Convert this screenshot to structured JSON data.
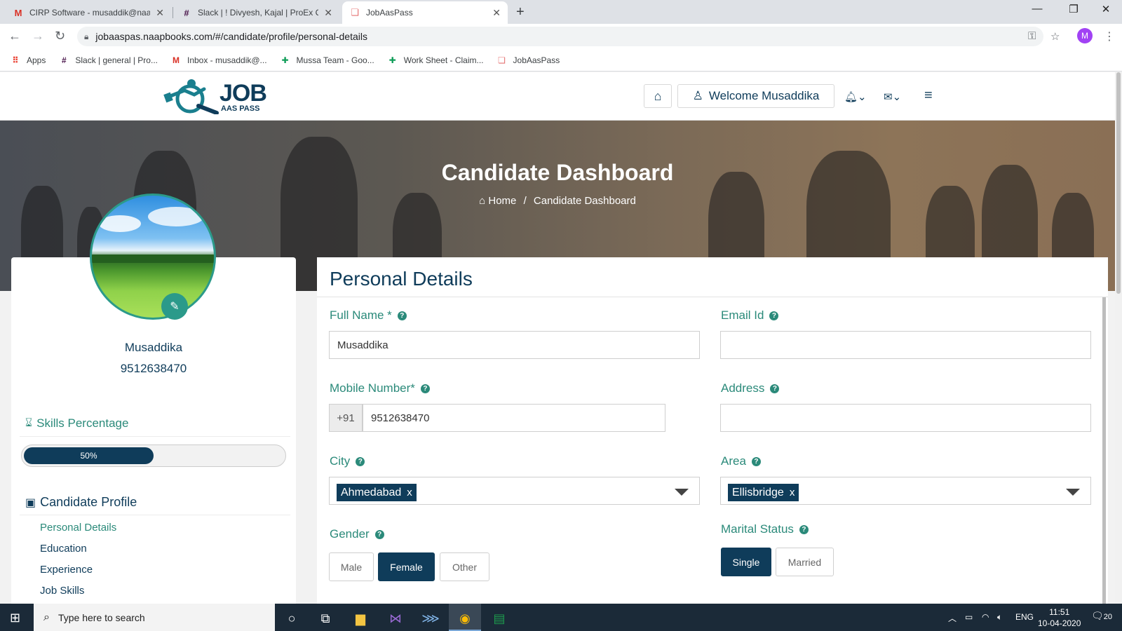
{
  "browser": {
    "tabs": [
      {
        "title": "CIRP Software - musaddik@naap",
        "icon": "gmail-icon"
      },
      {
        "title": "Slack | ! Divyesh, Kajal | ProEx Co",
        "icon": "slack-icon"
      },
      {
        "title": "JobAasPass",
        "icon": "jobaaspass-icon"
      }
    ],
    "url": "jobaaspas.naapbooks.com/#/candidate/profile/personal-details",
    "profile_initial": "M",
    "bookmarks": [
      {
        "label": "Apps"
      },
      {
        "label": "Slack | general | Pro..."
      },
      {
        "label": "Inbox - musaddik@..."
      },
      {
        "label": "Mussa Team - Goo..."
      },
      {
        "label": "Work Sheet - Claim..."
      },
      {
        "label": "JobAasPass"
      }
    ]
  },
  "header": {
    "logo_main": "JOB",
    "logo_sub": "AAS PASS",
    "welcome": "Welcome Musaddika"
  },
  "banner": {
    "title": "Candidate Dashboard",
    "breadcrumb_home": "Home",
    "breadcrumb_sep": "/",
    "breadcrumb_current": "Candidate Dashboard"
  },
  "profile": {
    "name": "Musaddika",
    "mobile": "9512638470",
    "skills_title": "Skills Percentage",
    "skills_percent": 50,
    "skills_label": "50%",
    "profile_title": "Candidate Profile",
    "menu": [
      "Personal Details",
      "Education",
      "Experience",
      "Job Skills"
    ]
  },
  "form": {
    "title": "Personal Details",
    "full_name_label": "Full Name *",
    "full_name_value": "Musaddika",
    "email_label": "Email Id",
    "email_value": "",
    "mobile_label": "Mobile Number*",
    "mobile_prefix": "+91",
    "mobile_value": "9512638470",
    "address_label": "Address",
    "address_value": "",
    "city_label": "City",
    "city_value": "Ahmedabad",
    "area_label": "Area",
    "area_value": "Ellisbridge",
    "chip_remove": "x",
    "gender_label": "Gender",
    "gender_options": [
      "Male",
      "Female",
      "Other"
    ],
    "gender_selected": "Female",
    "marital_label": "Marital Status",
    "marital_options": [
      "Single",
      "Married"
    ],
    "marital_selected": "Single"
  },
  "taskbar": {
    "search_placeholder": "Type here to search",
    "lang": "ENG",
    "time": "11:51",
    "date": "10-04-2020",
    "notifications": "20"
  },
  "colors": {
    "brand": "#0f3c5a",
    "accent": "#2b8a7a"
  }
}
